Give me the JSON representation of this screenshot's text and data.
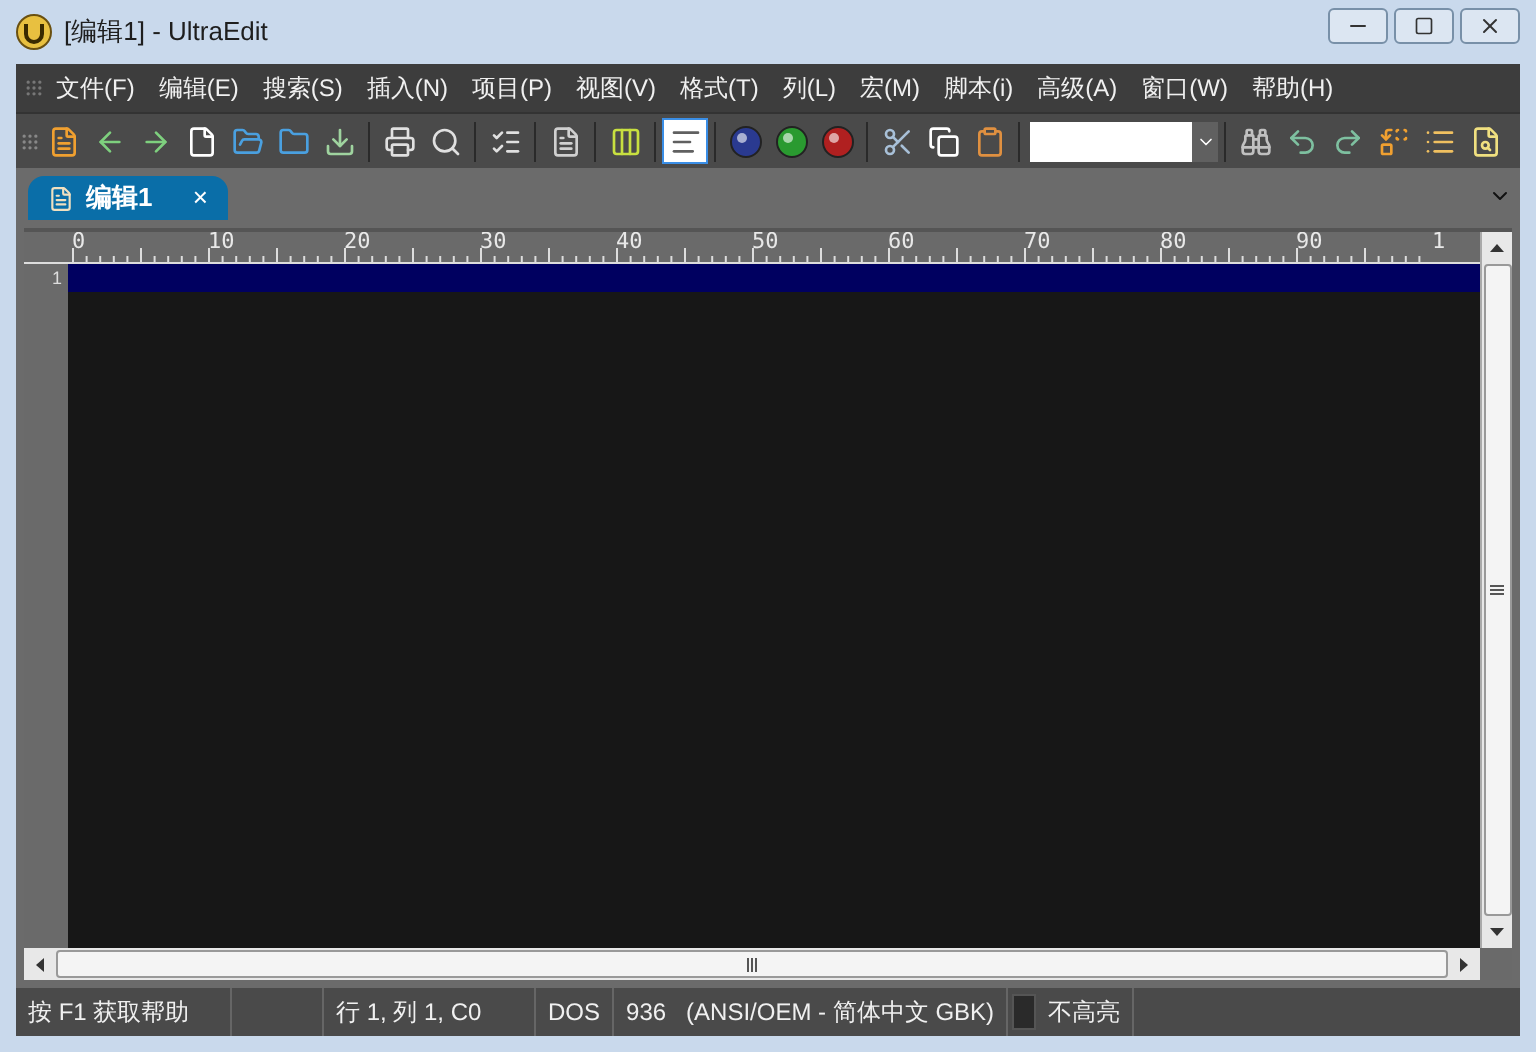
{
  "window": {
    "title": "[编辑1] - UltraEdit"
  },
  "menu": [
    "文件(F)",
    "编辑(E)",
    "搜索(S)",
    "插入(N)",
    "项目(P)",
    "视图(V)",
    "格式(T)",
    "列(L)",
    "宏(M)",
    "脚本(i)",
    "高级(A)",
    "窗口(W)",
    "帮助(H)"
  ],
  "tabs": [
    {
      "label": "编辑1",
      "selected": true,
      "close": "×"
    }
  ],
  "ruler": [
    "0",
    "10",
    "20",
    "30",
    "40",
    "50",
    "60",
    "70",
    "80",
    "90",
    "1"
  ],
  "editor": {
    "line_numbers": [
      "1"
    ]
  },
  "status_bar": [
    "按 F1 获取帮助",
    "行 1, 列 1, C0",
    "DOS",
    "936   (ANSI/OEM - 简体中文 GBK)",
    "不高亮"
  ]
}
